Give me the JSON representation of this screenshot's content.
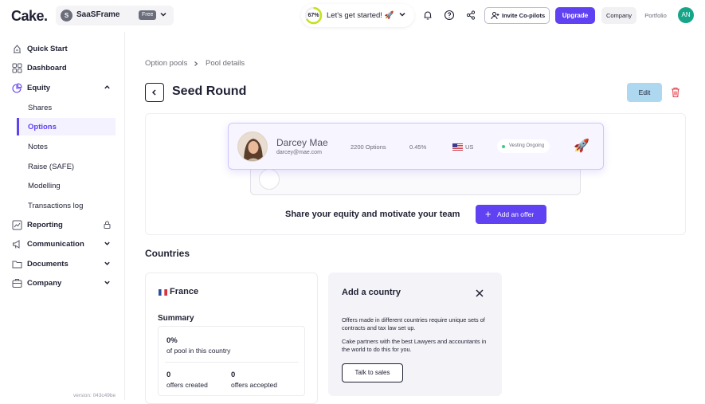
{
  "app": {
    "logo": "Cake."
  },
  "workspace": {
    "initial": "S",
    "name": "SaaSFrame",
    "plan": "Free"
  },
  "progress": {
    "percent": 67,
    "label": "67%",
    "text": "Let's get started! 🚀"
  },
  "topbar": {
    "invite_label": "Invite Co-pilots",
    "upgrade_label": "Upgrade",
    "context_company": "Company",
    "context_portfolio": "Portfolio",
    "user_initials": "AN",
    "accent_color": "#6142f2"
  },
  "sidebar": {
    "items": [
      {
        "label": "Quick Start",
        "icon": "rocket-icon"
      },
      {
        "label": "Dashboard",
        "icon": "grid-icon"
      },
      {
        "label": "Equity",
        "icon": "pie-chart-icon"
      },
      {
        "label": "Reporting",
        "icon": "chart-icon"
      },
      {
        "label": "Communication",
        "icon": "megaphone-icon"
      },
      {
        "label": "Documents",
        "icon": "folder-icon"
      },
      {
        "label": "Company",
        "icon": "building-icon"
      }
    ],
    "equity_sub": [
      "Shares",
      "Options",
      "Notes",
      "Raise (SAFE)",
      "Modelling",
      "Transactions log"
    ],
    "active_sub": "Options",
    "version": "version: 043c49be"
  },
  "main": {
    "breadcrumb": [
      "Option pools",
      "Pool details"
    ],
    "title": "Seed Round",
    "edit_label": "Edit",
    "promo": {
      "person_name": "Darcey Mae",
      "person_email": "darcey@mae.com",
      "options": "2200 Options",
      "percent": "0.45%",
      "country": "US",
      "status": "Vesting Ongoing",
      "headline": "Share your equity and motivate your team",
      "cta": "Add an offer"
    },
    "countries_title": "Countries",
    "country_card": {
      "name": "France",
      "summary_title": "Summary",
      "pool_pct": "0%",
      "pool_pct_label": "of pool in this country",
      "offers_created": "0",
      "offers_created_label": "offers created",
      "offers_accepted": "0",
      "offers_accepted_label": "offers accepted"
    },
    "add_country": {
      "title": "Add a country",
      "p1": "Offers made in different countries require unique sets of contracts and tax law set up.",
      "p2": "Cake partners with the best Lawyers and accountants in the world to do this for you.",
      "cta": "Talk to sales"
    }
  }
}
